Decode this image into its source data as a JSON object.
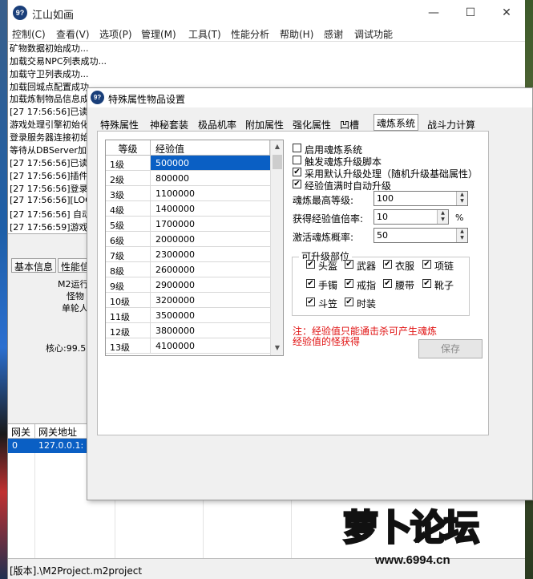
{
  "main_window": {
    "title": "江山如画",
    "icon_text": "9?",
    "menu": [
      "控制(C)",
      "查看(V)",
      "选项(P)",
      "管理(M)",
      "工具(T)",
      "性能分析",
      "帮助(H)",
      "感谢",
      "调试功能"
    ],
    "log_lines": [
      "矿物数据初始成功...",
      "加载交易NPC列表成功...",
      "加载守卫列表成功...",
      "加载回城点配置成功",
      "加载炼制物品信息成",
      "[27 17:56:56]已读",
      "游戏处理引擎初始化",
      "登录服务器连接初始",
      "等待从DBServer加载",
      "[27 17:56:56]已读",
      "[27 17:56:56]插件",
      "[27 17:56:56]登录",
      "[27 17:56:56][LOG",
      "[27 17:56:56] 自动",
      "[27 17:56:59]游戏"
    ],
    "lower_tabs": [
      "基本信息",
      "性能信"
    ],
    "stats": [
      "M2运行",
      "怪物",
      "单轮人",
      "核心:99.5"
    ],
    "gateway_table": {
      "headers": [
        "网关",
        "网关地址"
      ],
      "row": [
        "0",
        "127.0.0.1:"
      ]
    },
    "status_bar": "[版本].\\M2Project.m2project"
  },
  "dialog": {
    "title": "特殊属性物品设置",
    "icon_text": "9?",
    "tabs": [
      "特殊属性",
      "神秘套装",
      "极品机率",
      "附加属性",
      "强化属性",
      "凹槽",
      "魂炼系统",
      "战斗力计算"
    ],
    "active_tab": "魂炼系统",
    "level_table": {
      "headers": [
        "等级",
        "经验值"
      ],
      "rows": [
        [
          "1级",
          "500000"
        ],
        [
          "2级",
          "800000"
        ],
        [
          "3级",
          "1100000"
        ],
        [
          "4级",
          "1400000"
        ],
        [
          "5级",
          "1700000"
        ],
        [
          "6级",
          "2000000"
        ],
        [
          "7级",
          "2300000"
        ],
        [
          "8级",
          "2600000"
        ],
        [
          "9级",
          "2900000"
        ],
        [
          "10级",
          "3200000"
        ],
        [
          "11级",
          "3500000"
        ],
        [
          "12级",
          "3800000"
        ],
        [
          "13级",
          "4100000"
        ]
      ]
    },
    "options": [
      {
        "label": "启用魂炼系统",
        "checked": false
      },
      {
        "label": "触发魂炼升级脚本",
        "checked": false
      },
      {
        "label": "采用默认升级处理（随机升级基础属性）",
        "checked": true
      },
      {
        "label": "经验值满时自动升级",
        "checked": true
      }
    ],
    "fields": {
      "max_level": {
        "label": "魂炼最高等级:",
        "value": "100"
      },
      "exp_rate": {
        "label": "获得经验值倍率:",
        "value": "10",
        "unit": "%"
      },
      "activate_rate": {
        "label": "激活魂炼概率:",
        "value": "50"
      }
    },
    "parts_group": {
      "title": "可升级部位",
      "parts": [
        {
          "label": "头盔",
          "checked": true
        },
        {
          "label": "武器",
          "checked": true
        },
        {
          "label": "衣服",
          "checked": true
        },
        {
          "label": "项链",
          "checked": true
        },
        {
          "label": "手镯",
          "checked": true
        },
        {
          "label": "戒指",
          "checked": true
        },
        {
          "label": "腰带",
          "checked": true
        },
        {
          "label": "靴子",
          "checked": true
        },
        {
          "label": "斗笠",
          "checked": true
        },
        {
          "label": "时装",
          "checked": true
        }
      ]
    },
    "note": "注：经验值只能通击杀可产生魂炼经验值的怪获得",
    "save_label": "保存"
  },
  "watermark": {
    "text": "萝卜论坛",
    "url": "www.6994.cn"
  },
  "colors": {
    "selection": "#0a5fc4",
    "note_red": "#e01010",
    "logo_orange": "#ff8a1e"
  }
}
